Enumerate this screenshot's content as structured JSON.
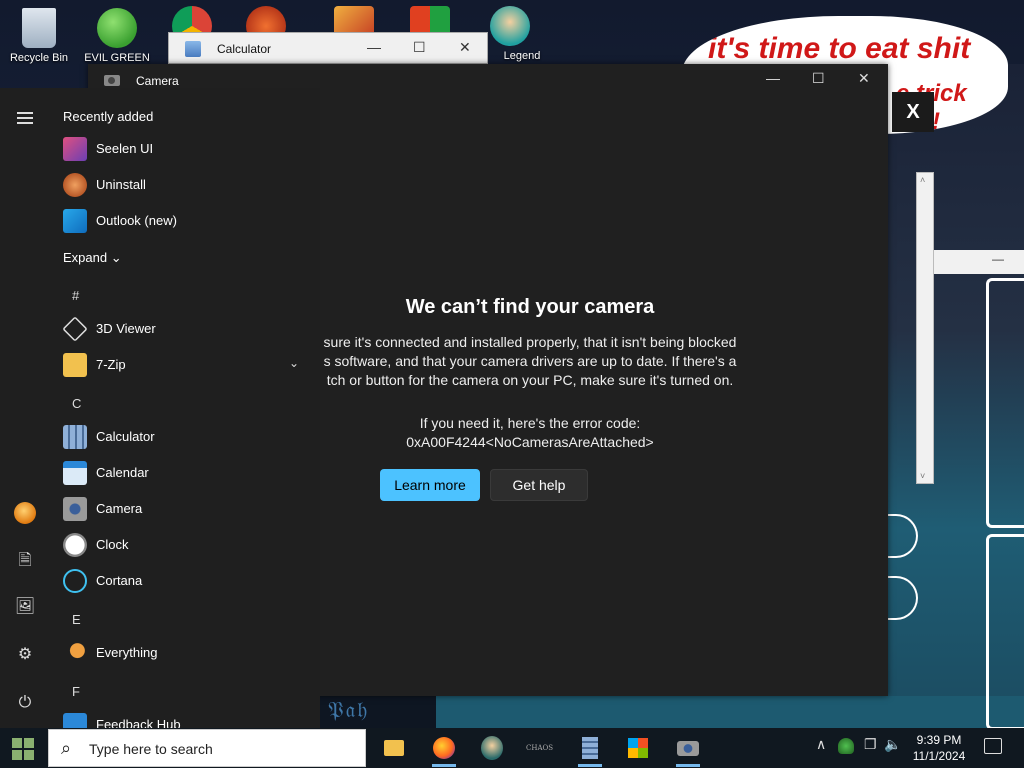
{
  "desktop": {
    "icons": [
      {
        "label": "Recycle Bin"
      },
      {
        "label": "EVIL GREEN"
      },
      {
        "label": "Legend"
      }
    ],
    "speech": {
      "line1": "it's time to eat shit",
      "line2": "e trick",
      "line3": "!"
    },
    "popup_close": "X",
    "scroll_up": "˄",
    "scroll_down": "˅",
    "panel_dash": "—"
  },
  "calculator_window": {
    "title": "Calculator",
    "minimize": "—",
    "maximize": "☐",
    "close": "✕"
  },
  "camera_window": {
    "title": "Camera",
    "minimize": "—",
    "maximize": "☐",
    "close": "✕",
    "error_title": "We can’t find your camera",
    "error_body": "sure it's connected and installed properly, that it isn't being blocked s software, and that your camera drivers are up to date. If there's a tch or button for the camera on your PC, make sure it's turned on.",
    "error_code_label": "If you need it, here's the error code:",
    "error_code": "0xA00F4244<NoCamerasAreAttached>",
    "learn_more": "Learn more",
    "get_help": "Get help"
  },
  "start_menu": {
    "recently_added": "Recently added",
    "recent_apps": [
      {
        "label": "Seelen UI",
        "icon": "seelen-icon",
        "color": "#6b3fb3"
      },
      {
        "label": "Uninstall",
        "icon": "uninstall-icon",
        "color": "#c0622e"
      },
      {
        "label": "Outlook (new)",
        "icon": "outlook-icon",
        "color": "#0f6cbd"
      }
    ],
    "expand": "Expand",
    "expand_chevron": "⌄",
    "letters": [
      "#",
      "C",
      "E",
      "F"
    ],
    "apps": [
      {
        "label": "3D Viewer",
        "icon": "3d-viewer-icon",
        "color": "#3a3a3a"
      },
      {
        "label": "7-Zip",
        "icon": "folder-icon",
        "color": "#f2c14e",
        "chevron": "⌄"
      },
      {
        "label": "Calculator",
        "icon": "calculator-icon",
        "color": "#6f8fb8"
      },
      {
        "label": "Calendar",
        "icon": "calendar-icon",
        "color": "#2b88d8"
      },
      {
        "label": "Camera",
        "icon": "camera-icon",
        "color": "#7a7a7a"
      },
      {
        "label": "Clock",
        "icon": "clock-icon",
        "color": "#d0d0d0"
      },
      {
        "label": "Cortana",
        "icon": "cortana-icon",
        "color": "#1f1f1f"
      },
      {
        "label": "Everything",
        "icon": "everything-icon",
        "color": "#e07a10"
      },
      {
        "label": "Feedback Hub",
        "icon": "feedback-hub-icon",
        "color": "#2b88d8"
      }
    ],
    "rail": {
      "document": "🗎",
      "pictures": "🖼",
      "settings": "⚙",
      "power": "⏻"
    }
  },
  "taskbar": {
    "search_placeholder": "Type here to search",
    "search_glyph": "⌕",
    "time": "9:39 PM",
    "date": "11/1/2024",
    "tray_chevron": "∧",
    "tray_network": "❐",
    "tray_volume": "🔈",
    "apps": [
      "file-explorer-icon",
      "firefox-icon",
      "game-icon",
      "chaos-icon",
      "calculator-icon",
      "store-icon",
      "camera-icon"
    ],
    "chaos_label": "CHAOS"
  },
  "colors": {
    "accent_button": "#4cc2ff",
    "window_bg": "#202020",
    "start_bg": "#1f1f1f",
    "speech_text": "#d01818"
  }
}
